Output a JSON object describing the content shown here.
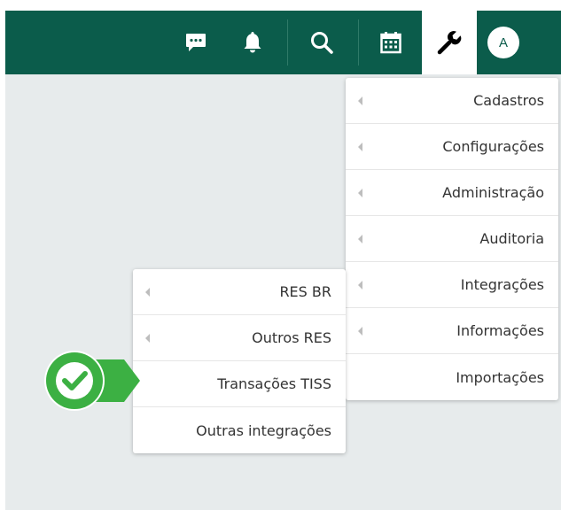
{
  "topbar": {
    "icons": [
      {
        "name": "chat-icon"
      },
      {
        "name": "bell-icon"
      },
      {
        "name": "search-icon"
      },
      {
        "name": "calendar-icon"
      },
      {
        "name": "wrench-icon"
      }
    ],
    "avatar_label": "A",
    "colors": {
      "bar": "#0b5c4b",
      "active": "#ffffff"
    }
  },
  "main_menu": {
    "items": [
      {
        "label": "Cadastros",
        "has_submenu": true
      },
      {
        "label": "Configurações",
        "has_submenu": true
      },
      {
        "label": "Administração",
        "has_submenu": true
      },
      {
        "label": "Auditoria",
        "has_submenu": true
      },
      {
        "label": "Integrações",
        "has_submenu": true
      },
      {
        "label": "Informações",
        "has_submenu": true
      },
      {
        "label": "Importações",
        "has_submenu": false
      }
    ]
  },
  "submenu": {
    "items": [
      {
        "label": "RES BR",
        "has_submenu": true
      },
      {
        "label": "Outros RES",
        "has_submenu": true
      },
      {
        "label": "Transações TISS",
        "has_submenu": false
      },
      {
        "label": "Outras integrações",
        "has_submenu": false
      }
    ]
  },
  "callout": {
    "icon": "checkmark-icon",
    "color": "#3cb043"
  }
}
